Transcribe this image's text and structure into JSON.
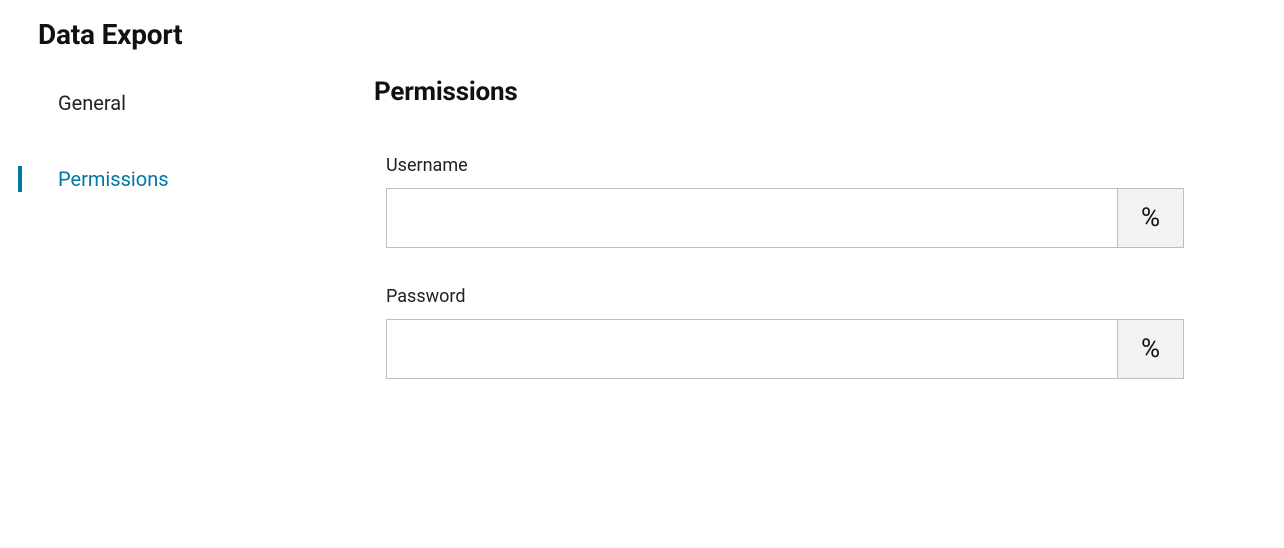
{
  "page_title": "Data Export",
  "sidebar": {
    "items": [
      {
        "label": "General",
        "active": false
      },
      {
        "label": "Permissions",
        "active": true
      }
    ]
  },
  "main": {
    "section_title": "Permissions",
    "fields": {
      "username": {
        "label": "Username",
        "value": "",
        "addon": "%"
      },
      "password": {
        "label": "Password",
        "value": "",
        "addon": "%"
      }
    }
  }
}
